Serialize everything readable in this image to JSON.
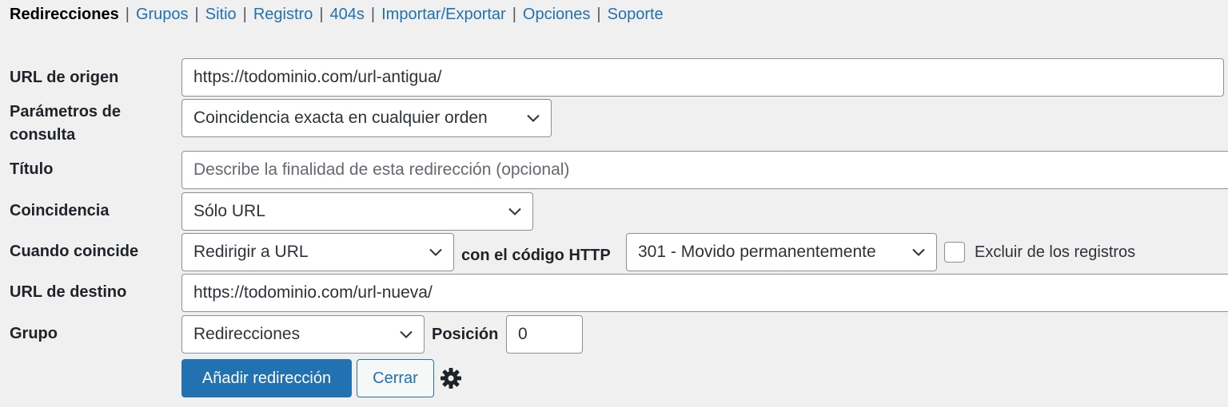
{
  "nav": {
    "current": "Redirecciones",
    "separator": "|",
    "links": [
      "Grupos",
      "Sitio",
      "Registro",
      "404s",
      "Importar/Exportar",
      "Opciones",
      "Soporte"
    ]
  },
  "form": {
    "source_url": {
      "label": "URL de origen",
      "value": "https://todominio.com/url-antigua/"
    },
    "query_params": {
      "label_line1": "Parámetros de",
      "label_line2": "consulta",
      "value": "Coincidencia exacta en cualquier orden"
    },
    "title": {
      "label": "Título",
      "placeholder": "Describe la finalidad de esta redirección (opcional)"
    },
    "match": {
      "label": "Coincidencia",
      "value": "Sólo URL"
    },
    "when_matched": {
      "label": "Cuando coincide",
      "action_value": "Redirigir a URL",
      "http_code_label": "con el código HTTP",
      "http_code_value": "301 - Movido permanentemente",
      "exclude_label": "Excluir de los registros",
      "exclude_checked": false
    },
    "target_url": {
      "label": "URL de destino",
      "value": "https://todominio.com/url-nueva/"
    },
    "group": {
      "label": "Grupo",
      "value": "Redirecciones",
      "position_label": "Posición",
      "position_value": "0"
    }
  },
  "buttons": {
    "add": "Añadir redirección",
    "close": "Cerrar"
  },
  "icons": {
    "options": "gear-icon",
    "dropdown": "chevron-down-icon"
  },
  "colors": {
    "accent": "#2271b1",
    "background": "#f0f0f1"
  }
}
